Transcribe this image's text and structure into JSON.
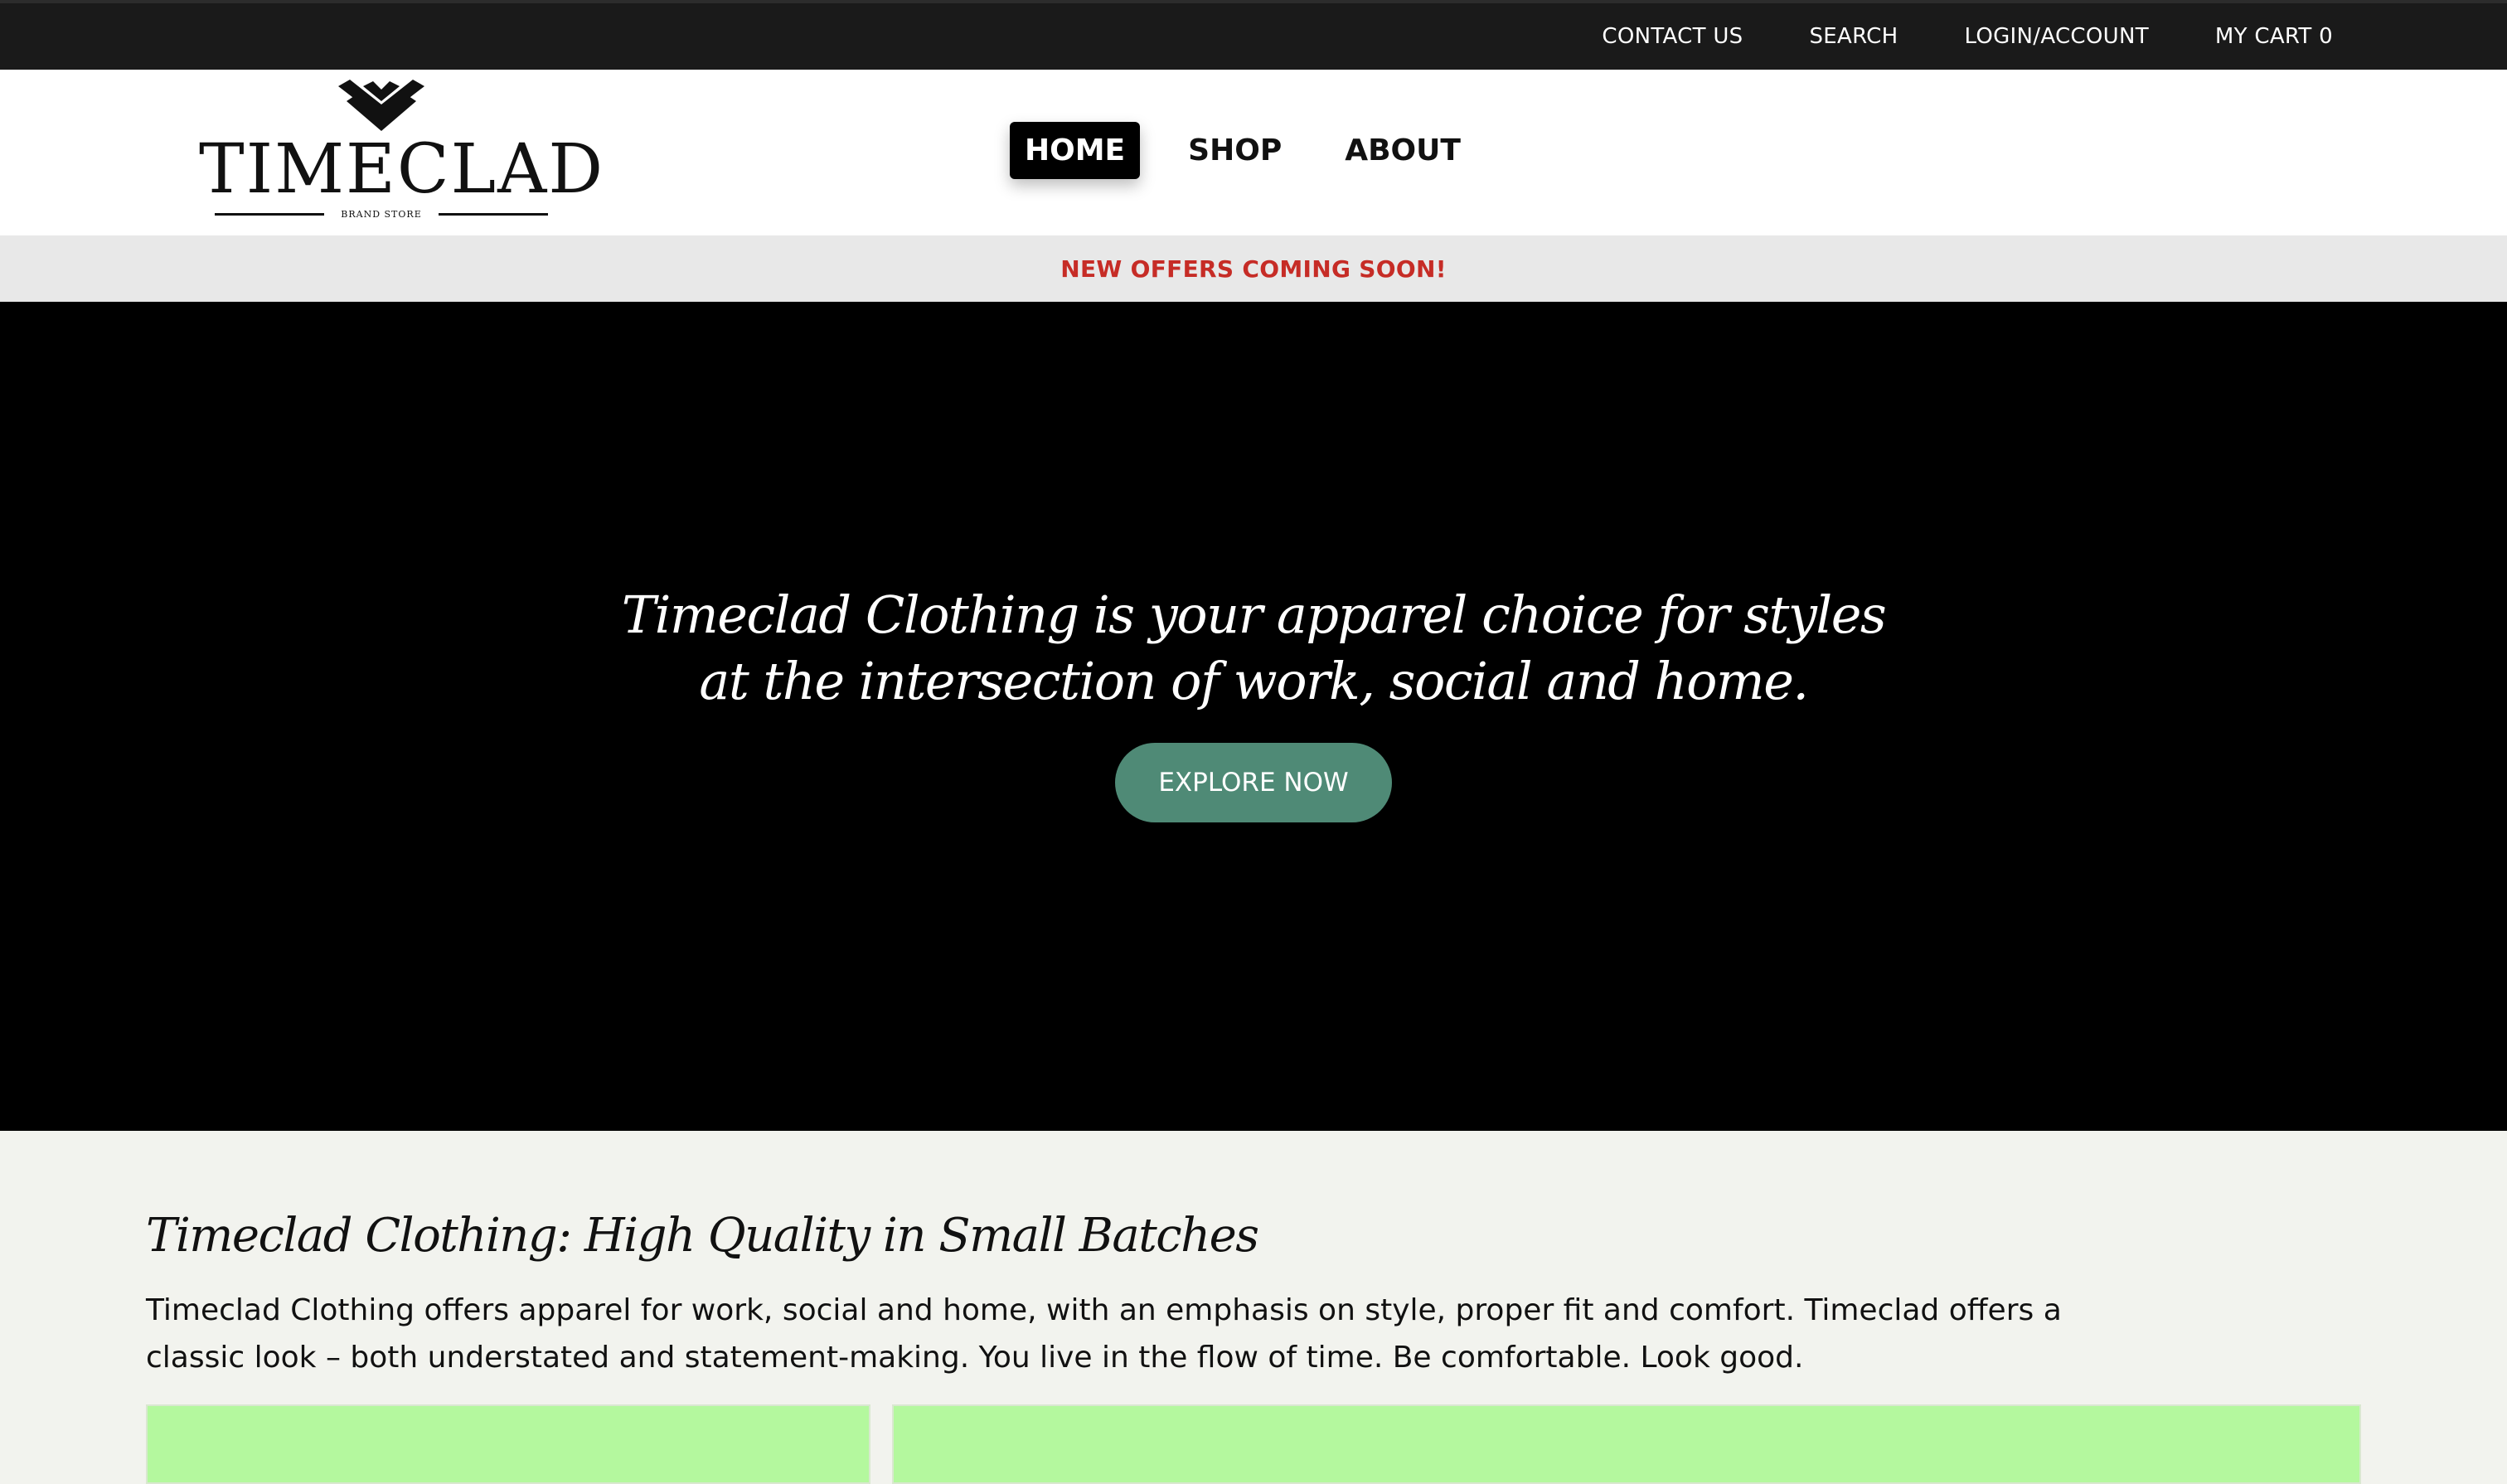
{
  "topbar": {
    "links": [
      {
        "label": "CONTACT US"
      },
      {
        "label": "SEARCH"
      },
      {
        "label": "LOGIN/ACCOUNT"
      },
      {
        "label": "MY CART 0"
      }
    ]
  },
  "header": {
    "logo": {
      "wordmark": "TIMECLAD",
      "tagline": "BRAND STORE"
    },
    "nav": [
      {
        "label": "HOME",
        "active": true
      },
      {
        "label": "SHOP",
        "active": false
      },
      {
        "label": "ABOUT",
        "active": false
      }
    ]
  },
  "announcement": {
    "text": "NEW OFFERS COMING SOON!",
    "color": "#c62c26"
  },
  "hero": {
    "title": "Timeclad Clothing is your apparel choice for styles at the intersection of work, social and home.",
    "button_label": "EXPLORE NOW",
    "button_color": "#4f8a76"
  },
  "intro": {
    "title": "Timeclad Clothing: High Quality in Small Batches",
    "body": "Timeclad Clothing offers apparel for work, social and home, with an emphasis on style, proper fit and comfort. Timeclad offers a classic look – both understated and statement-making. You live in the flow of time. Be comfortable. Look good."
  },
  "cards_color": "#b4f89e"
}
